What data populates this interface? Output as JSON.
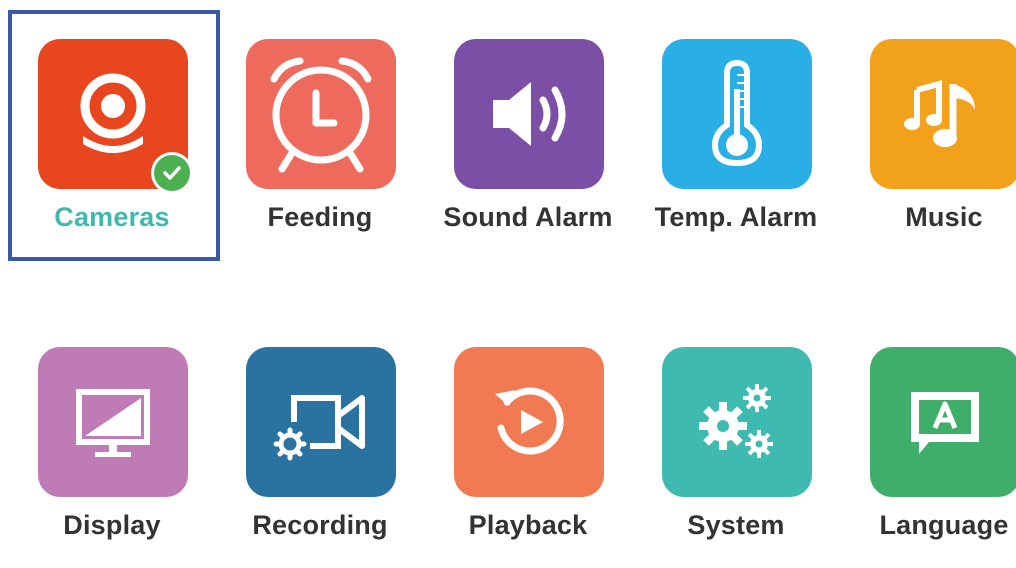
{
  "menu": {
    "selected_index": 0,
    "items": [
      {
        "label": "Cameras",
        "icon": "camera-icon",
        "color": "#e8461f",
        "selected": true
      },
      {
        "label": "Feeding",
        "icon": "alarm-clock-icon",
        "color": "#ee6a5c",
        "selected": false
      },
      {
        "label": "Sound Alarm",
        "icon": "speaker-icon",
        "color": "#7b4fa6",
        "selected": false
      },
      {
        "label": "Temp. Alarm",
        "icon": "thermometer-icon",
        "color": "#2aaee6",
        "selected": false
      },
      {
        "label": "Music",
        "icon": "music-note-icon",
        "color": "#f2a11b",
        "selected": false
      },
      {
        "label": "Display",
        "icon": "monitor-icon",
        "color": "#be7bb5",
        "selected": false
      },
      {
        "label": "Recording",
        "icon": "video-camera-icon",
        "color": "#2a73a0",
        "selected": false
      },
      {
        "label": "Playback",
        "icon": "replay-icon",
        "color": "#f17a52",
        "selected": false
      },
      {
        "label": "System",
        "icon": "gears-icon",
        "color": "#3fbab0",
        "selected": false
      },
      {
        "label": "Language",
        "icon": "language-icon",
        "color": "#3fae6a",
        "selected": false
      }
    ]
  },
  "colors": {
    "selected_label": "#3fb8ad",
    "selection_frame": "#3a5aa8",
    "check_badge": "#4caf50",
    "label": "#333333"
  }
}
